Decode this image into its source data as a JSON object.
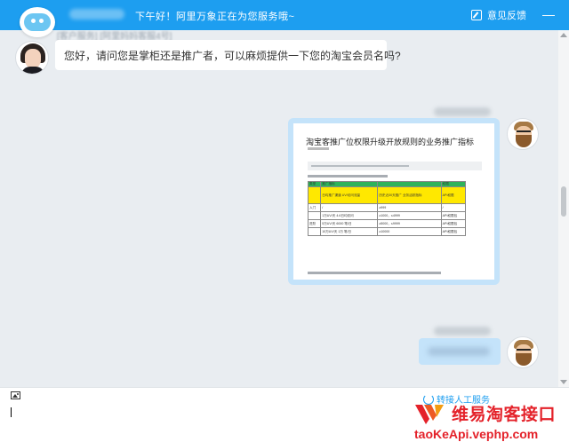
{
  "header": {
    "greeting": "下午好！阿里万象正在为您服务哦~",
    "feedback_label": "意见反馈",
    "minimize_symbol": "—",
    "bg_color": "#1d9ef0"
  },
  "chat": {
    "agent_message": "您好，请问您是掌柜还是推广者，可以麻烦提供一下您的淘宝会员名吗?",
    "top_strip_text": "[客户服务] [阿里妈妈客服4号]",
    "image_card": {
      "title": "淘宝客推广位权限升级开放规则的业务推广指标",
      "table_header": [
        "类型",
        "推广指标",
        "",
        "权限"
      ],
      "rows": [
        [
          "",
          "日均推广渠道 UV/访问流量",
          "历史近30天推广 业务活跃指标",
          "API权限"
        ],
        [
          "入门",
          "/",
          "≥999",
          "/"
        ],
        [
          "",
          "1万UV/天 4.6日均访问",
          "≥1000，≤4999",
          "API权限包"
        ],
        [
          "进阶",
          "5万UV/天 6000 笔/日",
          "≥5000，≤9999",
          "API权限包"
        ],
        [
          "",
          "10万UV/天 1万 笔/日",
          "≥10000",
          "API权限包"
        ]
      ]
    }
  },
  "input": {
    "human_service_label": "转接人工服务"
  },
  "watermark": {
    "brand_text": "维易淘客接口",
    "url_text": "taoKeApi.vephp.com"
  },
  "icons": [
    "image-icon",
    "feedback-icon",
    "minimize-icon",
    "human-service-icon"
  ]
}
